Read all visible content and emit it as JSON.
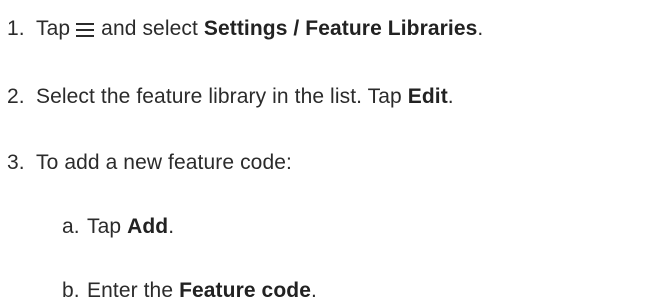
{
  "steps": [
    {
      "number": "1.",
      "pre": "Tap",
      "icon": "menu-icon",
      "mid": "and select",
      "bold": "Settings / Feature Libraries",
      "end": "."
    },
    {
      "number": "2.",
      "pre": "Select the feature library in the list. Tap",
      "bold": "Edit",
      "end": "."
    },
    {
      "number": "3.",
      "pre": "To add a new feature code:"
    }
  ],
  "substeps": [
    {
      "letter": "a.",
      "pre": "Tap",
      "bold": "Add",
      "end": "."
    },
    {
      "letter": "b.",
      "pre": "Enter the",
      "bold": "Feature code",
      "end": "."
    }
  ]
}
